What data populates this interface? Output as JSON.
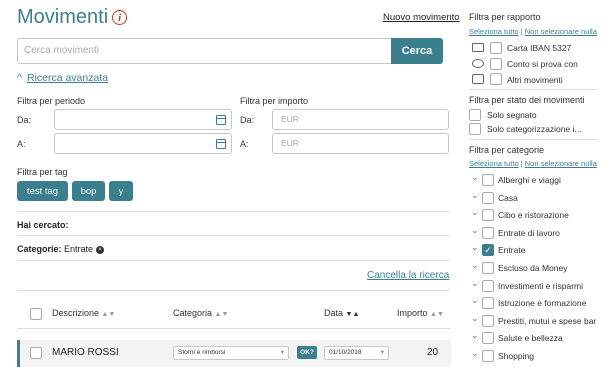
{
  "header": {
    "title": "Movimenti",
    "info_glyph": "i",
    "new_link": "Nuovo movimento"
  },
  "search": {
    "placeholder": "Cerca movimenti",
    "button": "Cerca"
  },
  "advanced": {
    "label": "Ricerca avanzata",
    "chevron": "^"
  },
  "filters": {
    "period_label": "Filtra per periodo",
    "from": "Da:",
    "to": "A:",
    "amount_label": "Filtra per importo",
    "amount_from": "Da:",
    "amount_to": "A:",
    "eur": "EUR",
    "tag_label": "Filtra per tag",
    "tags": [
      "test tag",
      "bop",
      "y"
    ]
  },
  "summary": {
    "searched": "Hai cercato:",
    "categories_label": "Categorie:",
    "categories_value": "Entrate",
    "remove_glyph": "×"
  },
  "cancel": "Cancella la ricerca",
  "table": {
    "headers": {
      "description": "Descrizione",
      "category": "Categoria",
      "date": "Data",
      "amount": "Importo"
    },
    "sort_glyph": "▲▼",
    "sort_active": "▼▲",
    "row": {
      "description": "MARIO ROSSI",
      "category": "Storni e rimborsi",
      "ok": "OK?",
      "date": "01/10/2018",
      "amount": "20"
    }
  },
  "sidebar": {
    "report_title": "Filtra per rapporto",
    "select_all": "Seleziona tutto",
    "select_none": "Non selezionare nulla",
    "sep": "|",
    "reports": [
      {
        "label": "Carta IBAN 5327",
        "icon": "card-icon"
      },
      {
        "label": "Conto si prova con",
        "icon": "piggy-bank-icon"
      },
      {
        "label": "Altri movimenti",
        "icon": "wallet-icon"
      }
    ],
    "state_title": "Filtra per stato dei movimenti",
    "states": [
      "Solo segnato",
      "Solo categorizzazione i..."
    ],
    "cat_title": "Filtra per categorie",
    "categories": [
      {
        "label": "Alberghi e viaggi",
        "checked": false
      },
      {
        "label": "Casa",
        "checked": false
      },
      {
        "label": "Cibo e ristorazione",
        "checked": false
      },
      {
        "label": "Entrate di lavoro",
        "checked": false
      },
      {
        "label": "Entrate",
        "checked": true
      },
      {
        "label": "Escluso da Money",
        "checked": false
      },
      {
        "label": "Investimenti e risparmi",
        "checked": false
      },
      {
        "label": "Istruzione e formazione",
        "checked": false
      },
      {
        "label": "Prestiti, mutui e spese bar",
        "checked": false
      },
      {
        "label": "Salute e bellezza",
        "checked": false
      },
      {
        "label": "Shopping",
        "checked": false
      }
    ],
    "chevron": "⌄",
    "check": "✓"
  }
}
